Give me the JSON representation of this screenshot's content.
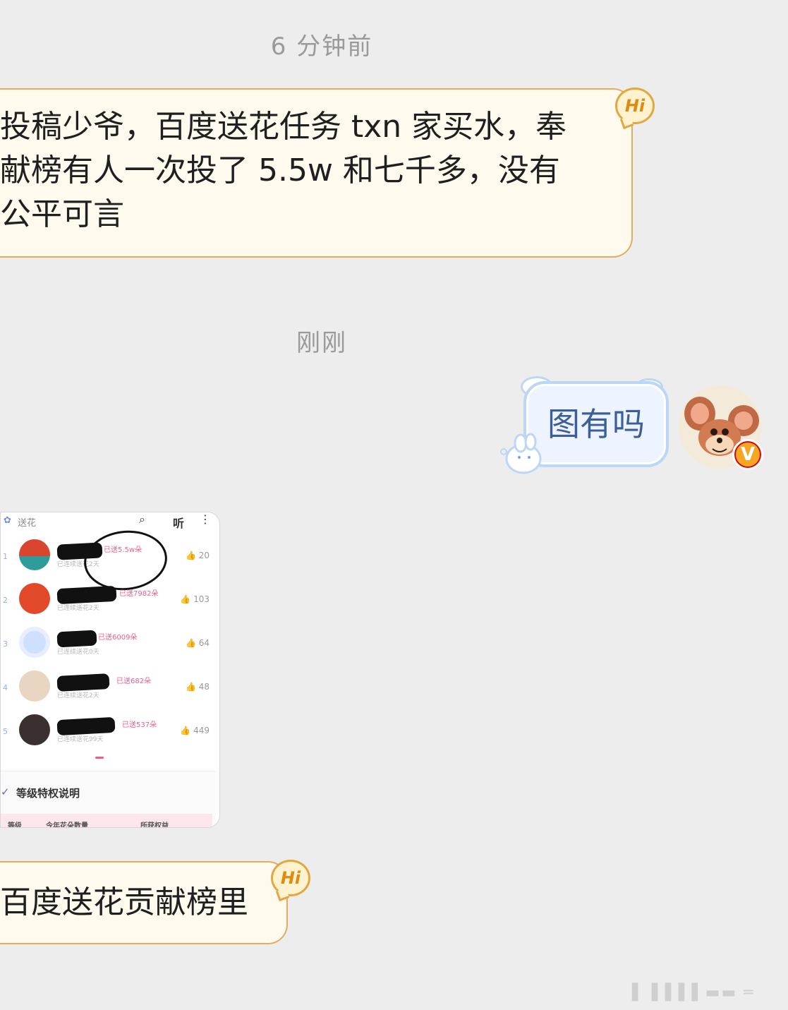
{
  "chat": {
    "timestamp_1": "6 分钟前",
    "message_1": {
      "line1": "投稿少爷，百度送花任务 txn 家买水，奉",
      "line2": "献榜有人一次投了 5.5w 和七千多，没有",
      "line3": "公平可言",
      "badge": "Hi"
    },
    "timestamp_2": "刚刚",
    "reply": {
      "text": "图有吗",
      "badge": "V"
    },
    "screenshot": {
      "search_placeholder": "送花",
      "listen_label": "听",
      "more_icon": "more-vertical-icon",
      "rows": [
        {
          "rank": "1",
          "tag": "已送5.5w朵",
          "sub": "已连续送花2天",
          "likes": "20",
          "avatar_color": "#d9452f"
        },
        {
          "rank": "2",
          "tag": "已送7982朵",
          "sub": "已连续送花2天",
          "likes": "103",
          "avatar_color": "#e2482a"
        },
        {
          "rank": "3",
          "tag": "已送6009朵",
          "sub": "已连续送花0天",
          "likes": "64",
          "avatar_color": "#cfe0ff"
        },
        {
          "rank": "4",
          "tag": "已送682朵",
          "sub": "已连续送花2天",
          "likes": "48",
          "avatar_color": "#e8d6c2"
        },
        {
          "rank": "5",
          "tag": "已送537朵",
          "sub": "已连续送花99天",
          "likes": "449",
          "avatar_color": "#3a3030"
        }
      ],
      "footer_title": "等级特权说明",
      "footer_cols": [
        "等级",
        "今年花朵数量",
        "所获权益"
      ]
    },
    "message_2": {
      "text": "百度送花贡献榜里",
      "badge": "Hi"
    }
  },
  "colors": {
    "background": "#ededed",
    "incoming_bubble": "#fffaee",
    "incoming_border": "#e2ad5c",
    "outgoing_bubble": "#eef4ff",
    "outgoing_border": "#bcd6f6"
  }
}
